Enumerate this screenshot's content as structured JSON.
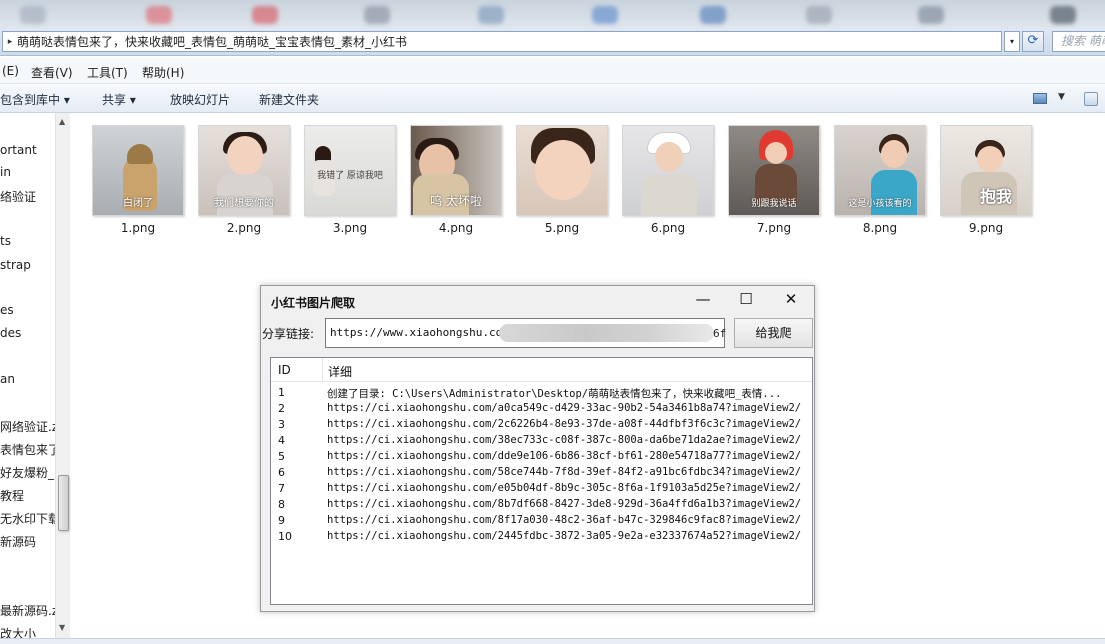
{
  "address_bar": {
    "path": "萌萌哒表情包来了，快来收藏吧_表情包_萌萌哒_宝宝表情包_素材_小红书",
    "search_placeholder": "搜索 萌萌"
  },
  "menu": [
    "(E)",
    "查看(V)",
    "工具(T)",
    "帮助(H)"
  ],
  "toolbar": {
    "include_library": "包含到库中 ▾",
    "share": "共享 ▾",
    "slideshow": "放映幻灯片",
    "new_folder": "新建文件夹"
  },
  "nav_items": [
    "ortant",
    "in",
    "络验证",
    "",
    "ts",
    "strap",
    "es",
    "des",
    "an",
    "网络验证.z",
    "表情包来了",
    "好友爆粉_",
    "教程",
    "无水印下载",
    "新源码",
    "最新源码.z",
    "改大小"
  ],
  "files": [
    {
      "name": "1.png",
      "caption": "白闭了",
      "icon": "image-thumbnail"
    },
    {
      "name": "2.png",
      "caption": "我们想要你的",
      "icon": "image-thumbnail"
    },
    {
      "name": "3.png",
      "caption": "我错了 原谅我吧",
      "icon": "image-thumbnail"
    },
    {
      "name": "4.png",
      "caption": "呜 太坏啦",
      "icon": "image-thumbnail"
    },
    {
      "name": "5.png",
      "caption": "",
      "icon": "image-thumbnail"
    },
    {
      "name": "6.png",
      "caption": "",
      "icon": "image-thumbnail"
    },
    {
      "name": "7.png",
      "caption": "别跟我说话",
      "icon": "image-thumbnail"
    },
    {
      "name": "8.png",
      "caption": "这是小孩该看的",
      "icon": "image-thumbnail"
    },
    {
      "name": "9.png",
      "caption": "抱我",
      "icon": "image-thumbnail"
    }
  ],
  "dialog": {
    "title": "小红书图片爬取",
    "minimize": "—",
    "maximize": "☐",
    "close": "✕",
    "share_label": "分享链接:",
    "url_value": "https://www.xiaohongshu.com/",
    "url_tail": "6f",
    "go_button": "给我爬",
    "columns": [
      "ID",
      "详细"
    ],
    "rows": [
      {
        "id": "1",
        "detail": "创建了目录: C:\\Users\\Administrator\\Desktop/萌萌哒表情包来了，快来收藏吧_表情..."
      },
      {
        "id": "2",
        "detail": "https://ci.xiaohongshu.com/a0ca549c-d429-33ac-90b2-54a3461b8a74?imageView2/2..."
      },
      {
        "id": "3",
        "detail": "https://ci.xiaohongshu.com/2c6226b4-8e93-37de-a08f-44dfbf3f6c3c?imageView2/2..."
      },
      {
        "id": "4",
        "detail": "https://ci.xiaohongshu.com/38ec733c-c08f-387c-800a-da6be71da2ae?imageView2/2..."
      },
      {
        "id": "5",
        "detail": "https://ci.xiaohongshu.com/dde9e106-6b86-38cf-bf61-280e54718a77?imageView2/2..."
      },
      {
        "id": "6",
        "detail": "https://ci.xiaohongshu.com/58ce744b-7f8d-39ef-84f2-a91bc6fdbc34?imageView2/2..."
      },
      {
        "id": "7",
        "detail": "https://ci.xiaohongshu.com/e05b04df-8b9c-305c-8f6a-1f9103a5d25e?imageView2/2..."
      },
      {
        "id": "8",
        "detail": "https://ci.xiaohongshu.com/8b7df668-8427-3de8-929d-36a4ffd6a1b3?imageView2/2..."
      },
      {
        "id": "9",
        "detail": "https://ci.xiaohongshu.com/8f17a030-48c2-36af-b47c-329846c9fac8?imageView2/2..."
      },
      {
        "id": "10",
        "detail": "https://ci.xiaohongshu.com/2445fdbc-3872-3a05-9e2a-e32337674a52?imageView2/2..."
      }
    ]
  },
  "colors": {
    "accent": "#2a62b5",
    "toolbar_bg": "#e4ecf5",
    "dialog_bg": "#f0f0f0"
  }
}
